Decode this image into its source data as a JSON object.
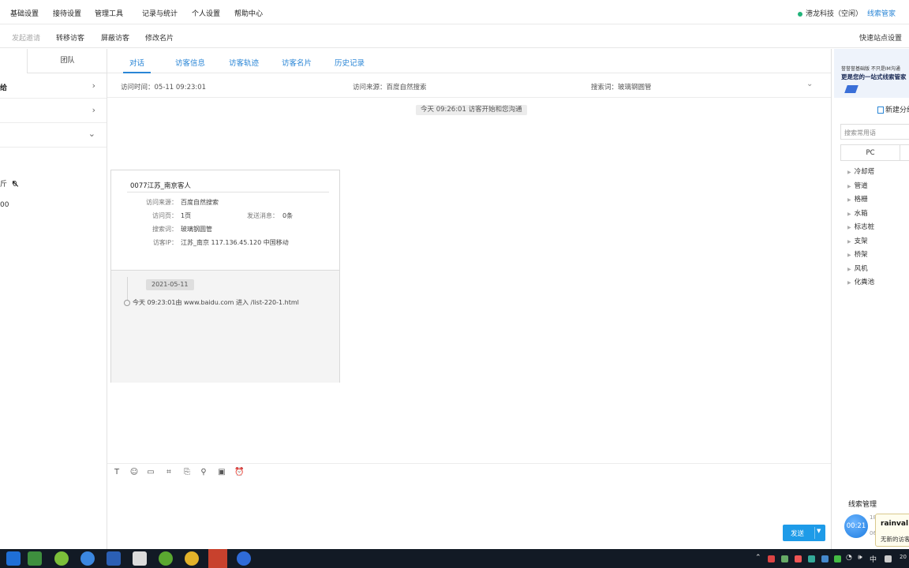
{
  "top_menu": {
    "items": [
      "基础设置",
      "接待设置",
      "管理工具",
      "记录与统计",
      "个人设置",
      "帮助中心"
    ],
    "status": "港龙科技（空闲）",
    "brand": "线索管家"
  },
  "toolbar": {
    "invite": "发起邀请",
    "transfer": "转移访客",
    "block": "屏蔽访客",
    "edit_card": "修改名片",
    "quick_setup": "快速站点设置"
  },
  "sidebar": {
    "team_tab": "团队",
    "row1_label": "给",
    "line_a": "斤",
    "line_a_val": "0",
    "line_b": "00"
  },
  "tabs": [
    "对话",
    "访客信息",
    "访客轨迹",
    "访客名片",
    "历史记录"
  ],
  "visit_bar": {
    "time": "访问时间：05-11 09:23:01",
    "source": "访问来源：百度自然搜索",
    "keyword": "搜索词：玻璃钢圆管"
  },
  "system_message": "今天 09:26:01 访客开始和您沟通",
  "visitor_card": {
    "name": "0077江苏_南京客人",
    "source_label": "访问来源：",
    "source": "百度自然搜索",
    "pages_label": "访问页：",
    "pages": "1页",
    "messages_label": "发送消息：",
    "messages": "0条",
    "keyword_label": "搜索词：",
    "keyword": "玻璃钢圆管",
    "ip_label": "访客IP：",
    "ip": "江苏_南京 117.136.45.120 中国移动",
    "date": "2021-05-11",
    "trail": "今天 09:23:01由 www.baidu.com 进入 /list-220-1.html"
  },
  "editor": {
    "tools": [
      "text-icon",
      "emoji-icon",
      "image-icon",
      "screenshot-icon",
      "file-icon",
      "location-icon",
      "card-icon",
      "alarm-icon"
    ],
    "send": "发送"
  },
  "right_panel": {
    "banner_line1": "誉誉誉基础版 不只是IM沟通",
    "banner_line2": "更是您的一站式线索管家",
    "new_group": "新建分组",
    "search_placeholder": "搜索常用语",
    "seg_pc": "PC",
    "categories": [
      "冷却塔",
      "管道",
      "格栅",
      "水箱",
      "标志桩",
      "支架",
      "桥架",
      "风机",
      "化粪池"
    ],
    "clue_title": "线索管理",
    "timer": "00:21",
    "faint1": "189",
    "faint2": "06",
    "popup_name": "rainval",
    "popup_text": "无新的访客"
  },
  "taskbar": {
    "ime": "中",
    "clock": "20"
  }
}
